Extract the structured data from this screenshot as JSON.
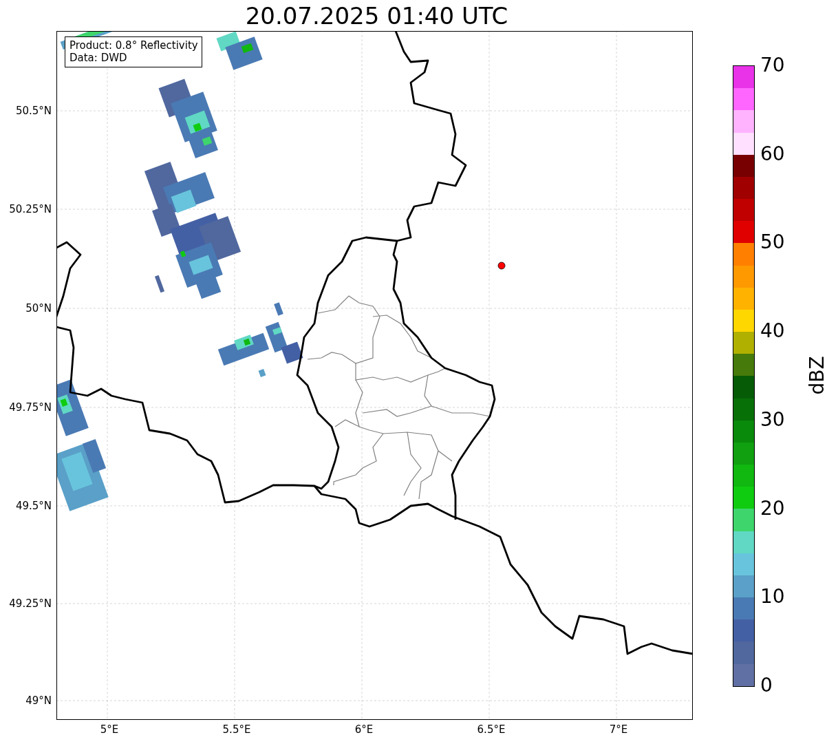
{
  "title": "20.07.2025 01:40 UTC",
  "info_box": {
    "lines": [
      "Product: 0.8° Reflectivity",
      "Data: DWD"
    ]
  },
  "y_axis": {
    "tick_labels": [
      "50.5°N",
      "50.25°N",
      "50°N",
      "49.75°N",
      "49.5°N",
      "49.25°N",
      "49°N"
    ]
  },
  "x_axis": {
    "tick_labels": [
      "5°E",
      "5.5°E",
      "6°E",
      "6.5°E",
      "7°E"
    ]
  },
  "colorbar": {
    "label": "dBZ",
    "tick_labels": [
      "70",
      "60",
      "50",
      "40",
      "30",
      "20",
      "10",
      "0"
    ],
    "segments": [
      {
        "color": "#e833e8"
      },
      {
        "color": "#ff66ff"
      },
      {
        "color": "#ffb3ff"
      },
      {
        "color": "#ffe0ff"
      },
      {
        "color": "#780000"
      },
      {
        "color": "#a00000"
      },
      {
        "color": "#c00000"
      },
      {
        "color": "#e00000"
      },
      {
        "color": "#ff8000"
      },
      {
        "color": "#ff9900"
      },
      {
        "color": "#ffb300"
      },
      {
        "color": "#ffd700"
      },
      {
        "color": "#b0b000"
      },
      {
        "color": "#467a0a"
      },
      {
        "color": "#065c06"
      },
      {
        "color": "#077007"
      },
      {
        "color": "#0a8a0a"
      },
      {
        "color": "#10a010"
      },
      {
        "color": "#10b810"
      },
      {
        "color": "#10cc10"
      },
      {
        "color": "#3ed66c"
      },
      {
        "color": "#60d8c4"
      },
      {
        "color": "#68c4dc"
      },
      {
        "color": "#5aa0c8"
      },
      {
        "color": "#4a7ab4"
      },
      {
        "color": "#4460a4"
      },
      {
        "color": "#50689e"
      },
      {
        "color": "#6070a4"
      }
    ]
  }
}
